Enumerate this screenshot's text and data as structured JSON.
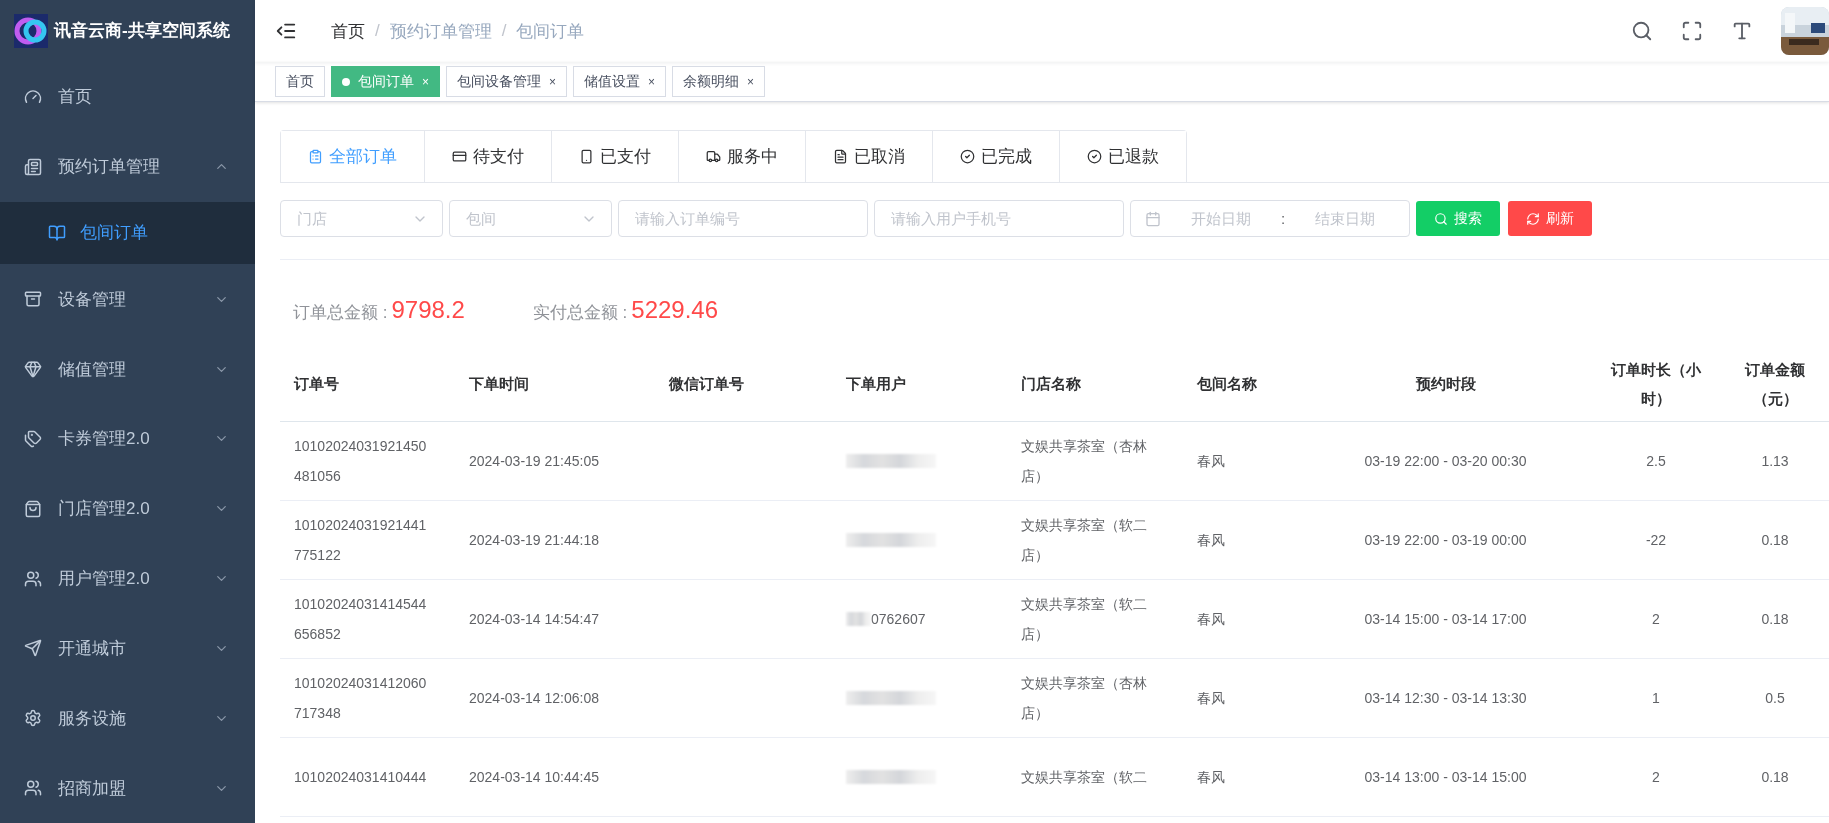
{
  "brand": {
    "title": "讯音云商-共享空间系统"
  },
  "sidebar": {
    "items": [
      {
        "label": "首页"
      },
      {
        "label": "预约订单管理",
        "expanded": true,
        "children": [
          {
            "label": "包间订单",
            "selected": true
          }
        ]
      },
      {
        "label": "设备管理",
        "expanded": false
      },
      {
        "label": "储值管理",
        "expanded": false
      },
      {
        "label": "卡券管理2.0",
        "expanded": false
      },
      {
        "label": "门店管理2.0",
        "expanded": false
      },
      {
        "label": "用户管理2.0",
        "expanded": false
      },
      {
        "label": "开通城市",
        "expanded": false
      },
      {
        "label": "服务设施",
        "expanded": false
      },
      {
        "label": "招商加盟",
        "expanded": false
      }
    ]
  },
  "breadcrumb": [
    {
      "label": "首页",
      "current": false
    },
    {
      "separator": "/",
      "label": "预约订单管理",
      "current": true
    },
    {
      "separator": "/",
      "label": "包间订单",
      "current": true
    }
  ],
  "page_tags": [
    {
      "label": "首页",
      "selected": false
    },
    {
      "label": "包间订单",
      "selected": true,
      "close": "×"
    },
    {
      "label": "包间设备管理",
      "selected": false,
      "close": "×"
    },
    {
      "label": "储值设置",
      "selected": false,
      "close": "×"
    },
    {
      "label": "余额明细",
      "selected": false,
      "close": "×"
    }
  ],
  "status_tabs": [
    {
      "label": "全部订单",
      "selected": true
    },
    {
      "label": "待支付",
      "selected": false
    },
    {
      "label": "已支付",
      "selected": false
    },
    {
      "label": "服务中",
      "selected": false
    },
    {
      "label": "已取消",
      "selected": false
    },
    {
      "label": "已完成",
      "selected": false
    },
    {
      "label": "已退款",
      "selected": false
    }
  ],
  "filters": {
    "store": {
      "placeholder": "门店"
    },
    "room": {
      "placeholder": "包间"
    },
    "order_no": {
      "placeholder": "请输入订单编号"
    },
    "phone": {
      "placeholder": "请输入用户手机号"
    },
    "date_range": {
      "start_placeholder": "开始日期",
      "separator": ":",
      "end_placeholder": "结束日期"
    },
    "search_button": "搜索",
    "refresh_button": "刷新"
  },
  "summary": [
    {
      "label": "订单总金额 :",
      "value": "9798.2"
    },
    {
      "label": "实付总金额 :",
      "value": "5229.46"
    }
  ],
  "table": {
    "columns": [
      "订单号",
      "下单时间",
      "微信订单号",
      "下单用户",
      "门店名称",
      "包间名称",
      "预约时段",
      "订单时长（小时）",
      "订单金额（元）"
    ],
    "rows": [
      {
        "order_no": "10102024031921450481056",
        "time": "2024-03-19 21:45:05",
        "store": "文娱共享茶室（杏林店）",
        "room": "春风",
        "slot": "03-19 22:00 - 03-20 00:30",
        "hours": "2.5",
        "amount": "1.13"
      },
      {
        "order_no": "10102024031921441775122",
        "time": "2024-03-19 21:44:18",
        "store": "文娱共享茶室（软二店）",
        "room": "春风",
        "slot": "03-19 22:00 - 03-19 00:00",
        "hours": "-22",
        "amount": "0.18"
      },
      {
        "order_no": "10102024031414544656852",
        "time": "2024-03-14 14:54:47",
        "user": "0762607",
        "store": "文娱共享茶室（软二店）",
        "room": "春风",
        "slot": "03-14 15:00 - 03-14 17:00",
        "hours": "2",
        "amount": "0.18"
      },
      {
        "order_no": "10102024031412060717348",
        "time": "2024-03-14 12:06:08",
        "store": "文娱共享茶室（杏林店）",
        "room": "春风",
        "slot": "03-14 12:30 - 03-14 13:30",
        "hours": "1",
        "amount": "0.5"
      },
      {
        "order_no": "10102024031410444",
        "time": "2024-03-14 10:44:45",
        "store": "文娱共享茶室（软二",
        "room": "春风",
        "slot": "03-14 13:00 - 03-14 15:00",
        "hours": "2",
        "amount": "0.18"
      }
    ]
  }
}
